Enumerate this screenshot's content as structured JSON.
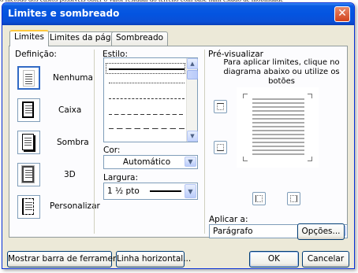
{
  "background_text": "o método dos custos possíveis obter o valor residual do terreno com base num estado de mobilidade",
  "window": {
    "title": "Limites e sombreado",
    "close_label": "✕"
  },
  "tabs": [
    {
      "label": "Limites"
    },
    {
      "label": "Limites da página"
    },
    {
      "label": "Sombreado"
    }
  ],
  "definition": {
    "heading": "Definição:",
    "options": [
      {
        "label": "Nenhuma",
        "icon": "none-border-icon",
        "selected": true
      },
      {
        "label": "Caixa",
        "icon": "box-border-icon",
        "selected": false
      },
      {
        "label": "Sombra",
        "icon": "shadow-border-icon",
        "selected": false
      },
      {
        "label": "3D",
        "icon": "3d-border-icon",
        "selected": false
      },
      {
        "label": "Personalizar",
        "icon": "custom-border-icon",
        "selected": false
      }
    ]
  },
  "style": {
    "heading": "Estilo:"
  },
  "color": {
    "label": "Cor:",
    "value": "Automático"
  },
  "width": {
    "label": "Largura:",
    "value": "1 ½ pto"
  },
  "preview": {
    "heading": "Pré-visualizar",
    "instructions": "Para aplicar limites, clique no diagrama abaixo ou utilize os botões"
  },
  "apply_to": {
    "label": "Aplicar a:",
    "value": "Parágrafo"
  },
  "buttons": {
    "options": "Opções...",
    "show_toolbar": "Mostrar barra de ferramentas",
    "horizontal_line": "Linha horizontal...",
    "ok": "OK",
    "cancel": "Cancelar"
  },
  "colors": {
    "titlebar": "#0a5be3",
    "dialog": "#ece9d8",
    "tab_highlight": "#ffc83c",
    "control_border": "#7f9db9"
  }
}
